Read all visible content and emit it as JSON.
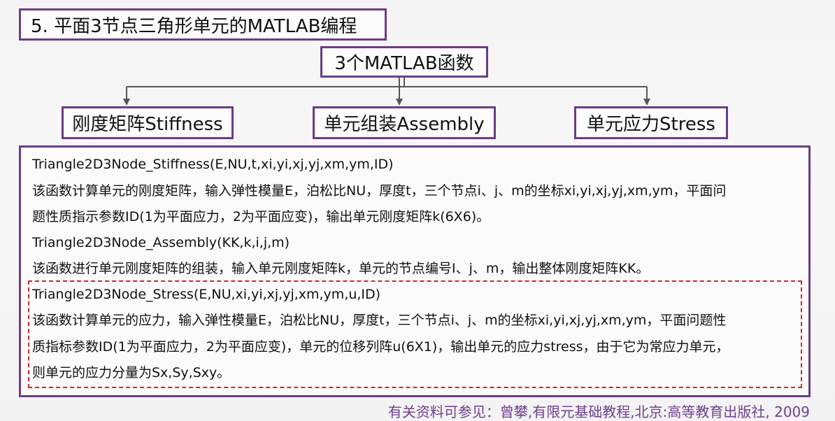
{
  "title": "5. 平面3节点三角形单元的MATLAB编程",
  "center_label": "3个MATLAB函数",
  "branches": [
    {
      "label": "刚度矩阵Stiffness"
    },
    {
      "label": "单元组装Assembly"
    },
    {
      "label": "单元应力Stress"
    }
  ],
  "content": {
    "stiffness_signature": "Triangle2D3Node_Stiffness(E,NU,t,xi,yi,xj,yj,xm,ym,ID)",
    "stiffness_desc_1": "该函数计算单元的刚度矩阵，输入弹性模量E，泊松比NU，厚度t，三个节点i、j、m的坐标xi,yi,xj,yj,xm,ym，平面问",
    "stiffness_desc_2": "题性质指示参数ID(1为平面应力，2为平面应变)，输出单元刚度矩阵k(6X6)。",
    "assembly_signature": "Triangle2D3Node_Assembly(KK,k,i,j,m)",
    "assembly_desc": "该函数进行单元刚度矩阵的组装，输入单元刚度矩阵k，单元的节点编号I、j、m，输出整体刚度矩阵KK。",
    "stress_signature": "Triangle2D3Node_Stress(E,NU,xi,yi,xj,yj,xm,ym,u,ID)",
    "stress_desc_1": "该函数计算单元的应力，输入弹性模量E，泊松比NU，厚度t，三个节点i、j、m的坐标xi,yi,xj,yj,xm,ym，平面问题性",
    "stress_desc_2": "质指标参数ID(1为平面应力，2为平面应变)，单元的位移列阵u(6X1)，输出单元的应力stress，由于它为常应力单元，",
    "stress_desc_3": "则单元的应力分量为Sx,Sy,Sxy。"
  },
  "footer": "有关资料可参见：曾攀,有限元基础教程,北京:高等教育出版社, 2009",
  "colors": {
    "border_purple": "#6a3d86",
    "dashed_red": "#c8292d",
    "footer_purple": "#6f3f8f"
  }
}
